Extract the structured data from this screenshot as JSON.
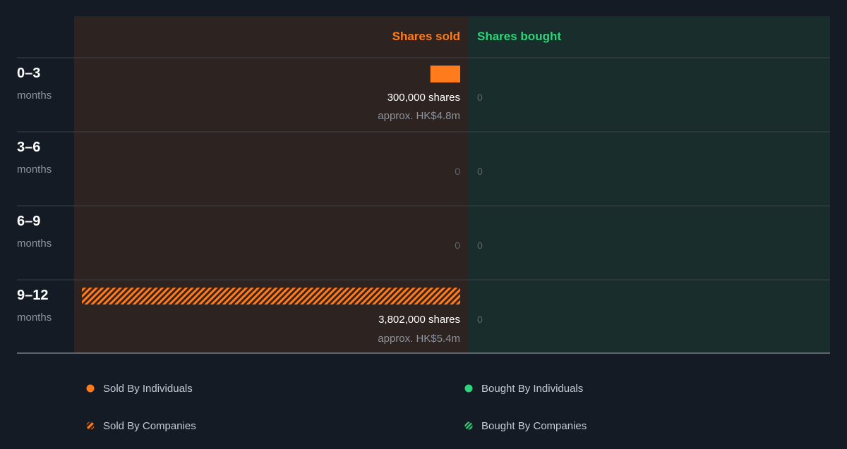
{
  "chart_data": {
    "type": "bar",
    "column_headers": {
      "sold": "Shares sold",
      "bought": "Shares bought"
    },
    "unit_label": "months",
    "categories": [
      "0–3",
      "3–6",
      "6–9",
      "9–12"
    ],
    "series": [
      {
        "name": "Sold By Individuals",
        "side": "sold",
        "values": [
          300000,
          0,
          0,
          0
        ]
      },
      {
        "name": "Sold By Companies",
        "side": "sold",
        "values": [
          0,
          0,
          0,
          3802000
        ]
      },
      {
        "name": "Bought By Individuals",
        "side": "bought",
        "values": [
          0,
          0,
          0,
          0
        ]
      },
      {
        "name": "Bought By Companies",
        "side": "bought",
        "values": [
          0,
          0,
          0,
          0
        ]
      }
    ],
    "labels": [
      {
        "shares": "300,000 shares",
        "approx": "approx. HK$4.8m",
        "sold_zero": "",
        "bought_zero": "0"
      },
      {
        "shares": "",
        "approx": "",
        "sold_zero": "0",
        "bought_zero": "0"
      },
      {
        "shares": "",
        "approx": "",
        "sold_zero": "0",
        "bought_zero": "0"
      },
      {
        "shares": "3,802,000 shares",
        "approx": "approx. HK$5.4m",
        "sold_zero": "",
        "bought_zero": "0"
      }
    ],
    "legend": [
      {
        "label": "Sold By Individuals",
        "marker": "dot",
        "color": "#ff7b1c"
      },
      {
        "label": "Bought By Individuals",
        "marker": "dot",
        "color": "#2ed47a"
      },
      {
        "label": "Sold By Companies",
        "marker": "hatched",
        "color": "#ff7b1c"
      },
      {
        "label": "Bought By Companies",
        "marker": "hatched",
        "color": "#2ed47a"
      }
    ],
    "legend_position": "bottom",
    "colors": {
      "background": "#151b24",
      "sold_panel": "#2d2320",
      "bought_panel": "#182d2c",
      "sold": "#ff7b1c",
      "bought": "#2ed47a"
    }
  }
}
